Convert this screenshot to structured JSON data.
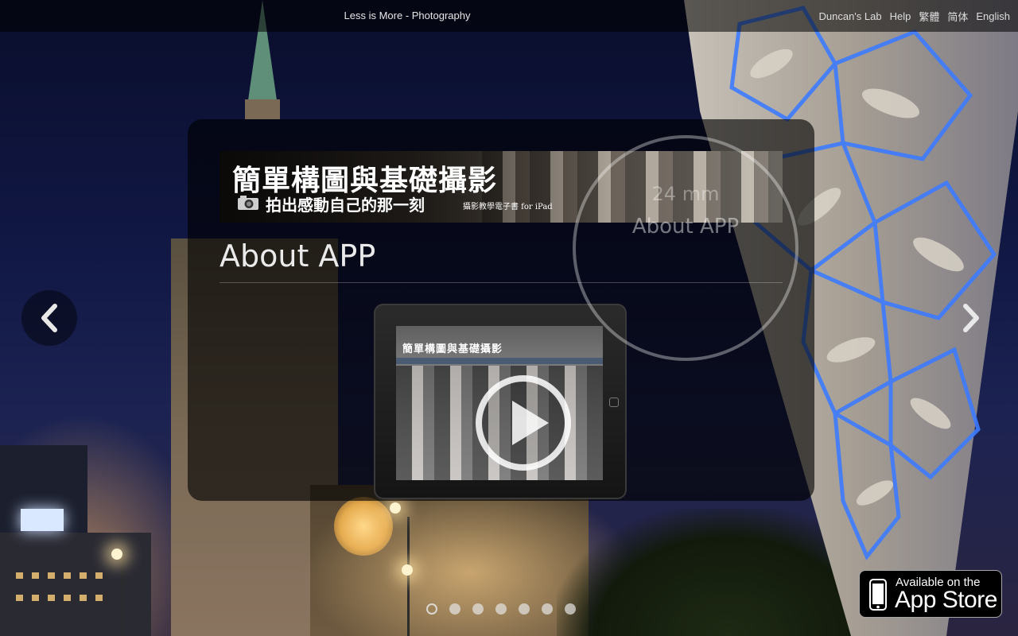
{
  "header": {
    "title": "Less is More - Photography",
    "nav": [
      "Duncan's Lab",
      "Help",
      "繁體",
      "简体",
      "English"
    ]
  },
  "banner": {
    "title": "簡單構圖與基礎攝影",
    "subtitle": "拍出感動自己的那一刻",
    "tagline": "攝影教學電子書 for iPad"
  },
  "section": {
    "heading": "About APP"
  },
  "video": {
    "screen_title": "簡單構圖與基礎攝影"
  },
  "lens_overlay": {
    "focal_length": "24 mm",
    "label": "About APP"
  },
  "carousel": {
    "slide_count": 7,
    "active_index": 0
  },
  "app_store": {
    "line1": "Available on the",
    "line2": "App Store"
  },
  "icons": [
    "chevron-left-icon",
    "chevron-right-icon",
    "play-icon",
    "camera-icon",
    "iphone-icon"
  ],
  "colors": {
    "panel_bg": "#000000",
    "text": "#eaeaea",
    "accent": "#4a5b74"
  }
}
